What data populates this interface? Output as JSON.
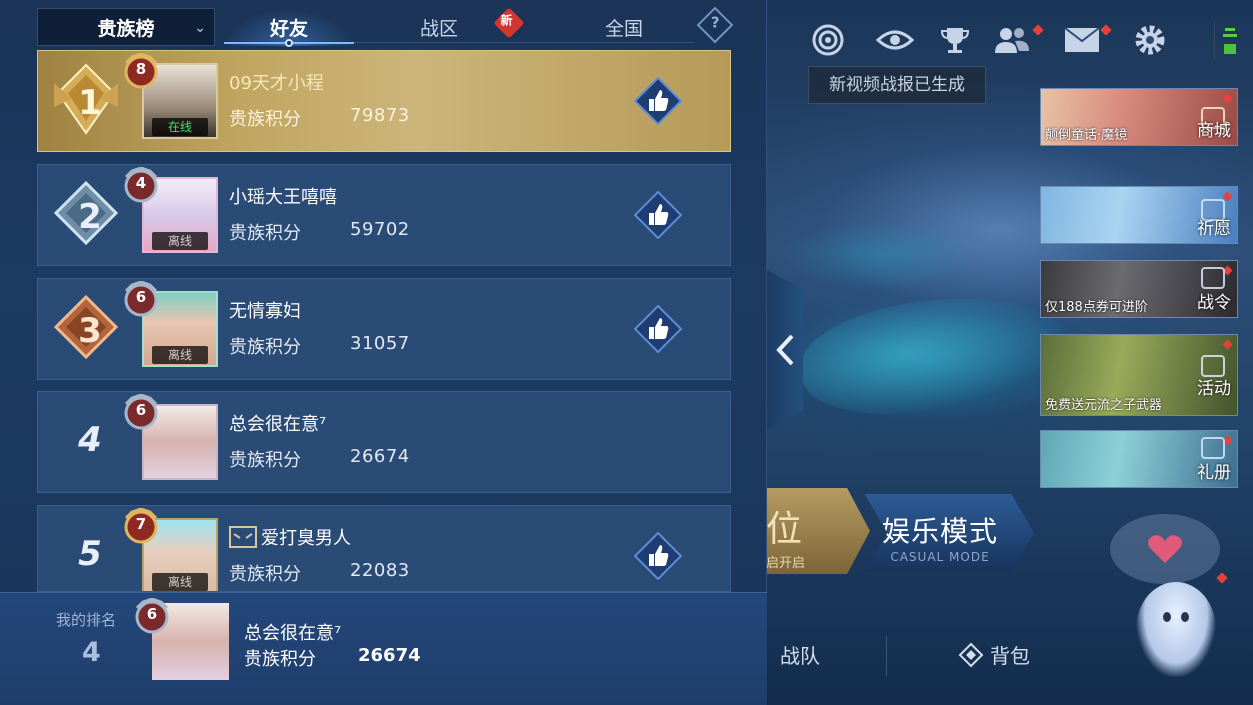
{
  "header": {
    "scope_select": "贵族榜",
    "tabs": [
      {
        "label": "好友",
        "active": true
      },
      {
        "label": "战区",
        "badge": "新"
      },
      {
        "label": "全国"
      }
    ],
    "help_icon": "?"
  },
  "leaderboard": {
    "score_label": "贵族积分",
    "rows": [
      {
        "rank": "1",
        "name": "09天才小程",
        "score": "79873",
        "noble_level": "8",
        "status": "在线",
        "highlighted": true,
        "likeable": true
      },
      {
        "rank": "2",
        "name": "小瑶大王嘻嘻",
        "score": "59702",
        "noble_level": "4",
        "status": "离线",
        "likeable": true
      },
      {
        "rank": "3",
        "name": "无情寡妇",
        "score": "31057",
        "noble_level": "6",
        "status": "离线",
        "likeable": true
      },
      {
        "rank": "4",
        "name": "总会很在意⁷",
        "score": "26674",
        "noble_level": "6",
        "status": "",
        "likeable": false
      },
      {
        "rank": "5",
        "name": "爱打臭男人",
        "score": "22083",
        "noble_level": "7",
        "status": "离线",
        "likeable": true
      }
    ]
  },
  "my_rank": {
    "label": "我的排名",
    "rank": "4",
    "noble_level": "6",
    "name": "总会很在意⁷",
    "score_label": "贵族积分",
    "score": "26674"
  },
  "right_side": {
    "tooltip": "新视频战报已生成",
    "promos": [
      {
        "caption": "颠倒童话·魔镜",
        "side_label": "商城"
      },
      {
        "caption": "",
        "side_label": "祈愿"
      },
      {
        "caption": "仅188点券可进阶",
        "side_label": "战令"
      },
      {
        "caption": "免费送元流之子武器",
        "side_label": "活动"
      },
      {
        "caption": "",
        "side_label": "礼册"
      }
    ],
    "mode_ranked": {
      "title": "位",
      "sub": "启开启"
    },
    "mode_casual": {
      "title": "娱乐模式",
      "sub": "CASUAL MODE"
    },
    "bottom_nav": [
      "战队",
      "背包"
    ]
  },
  "colors": {
    "gold_row": "#c1a661",
    "row_bg": "#294b75",
    "panel_bg": "#1b3457",
    "online": "#45e36b",
    "badge_red": "#d2362f"
  },
  "icons": [
    "spiral-icon",
    "eye-icon",
    "trophy-icon",
    "friends-icon",
    "mail-icon",
    "gear-icon",
    "thumbs-up-icon",
    "chevron-left-icon",
    "heart-icon"
  ]
}
